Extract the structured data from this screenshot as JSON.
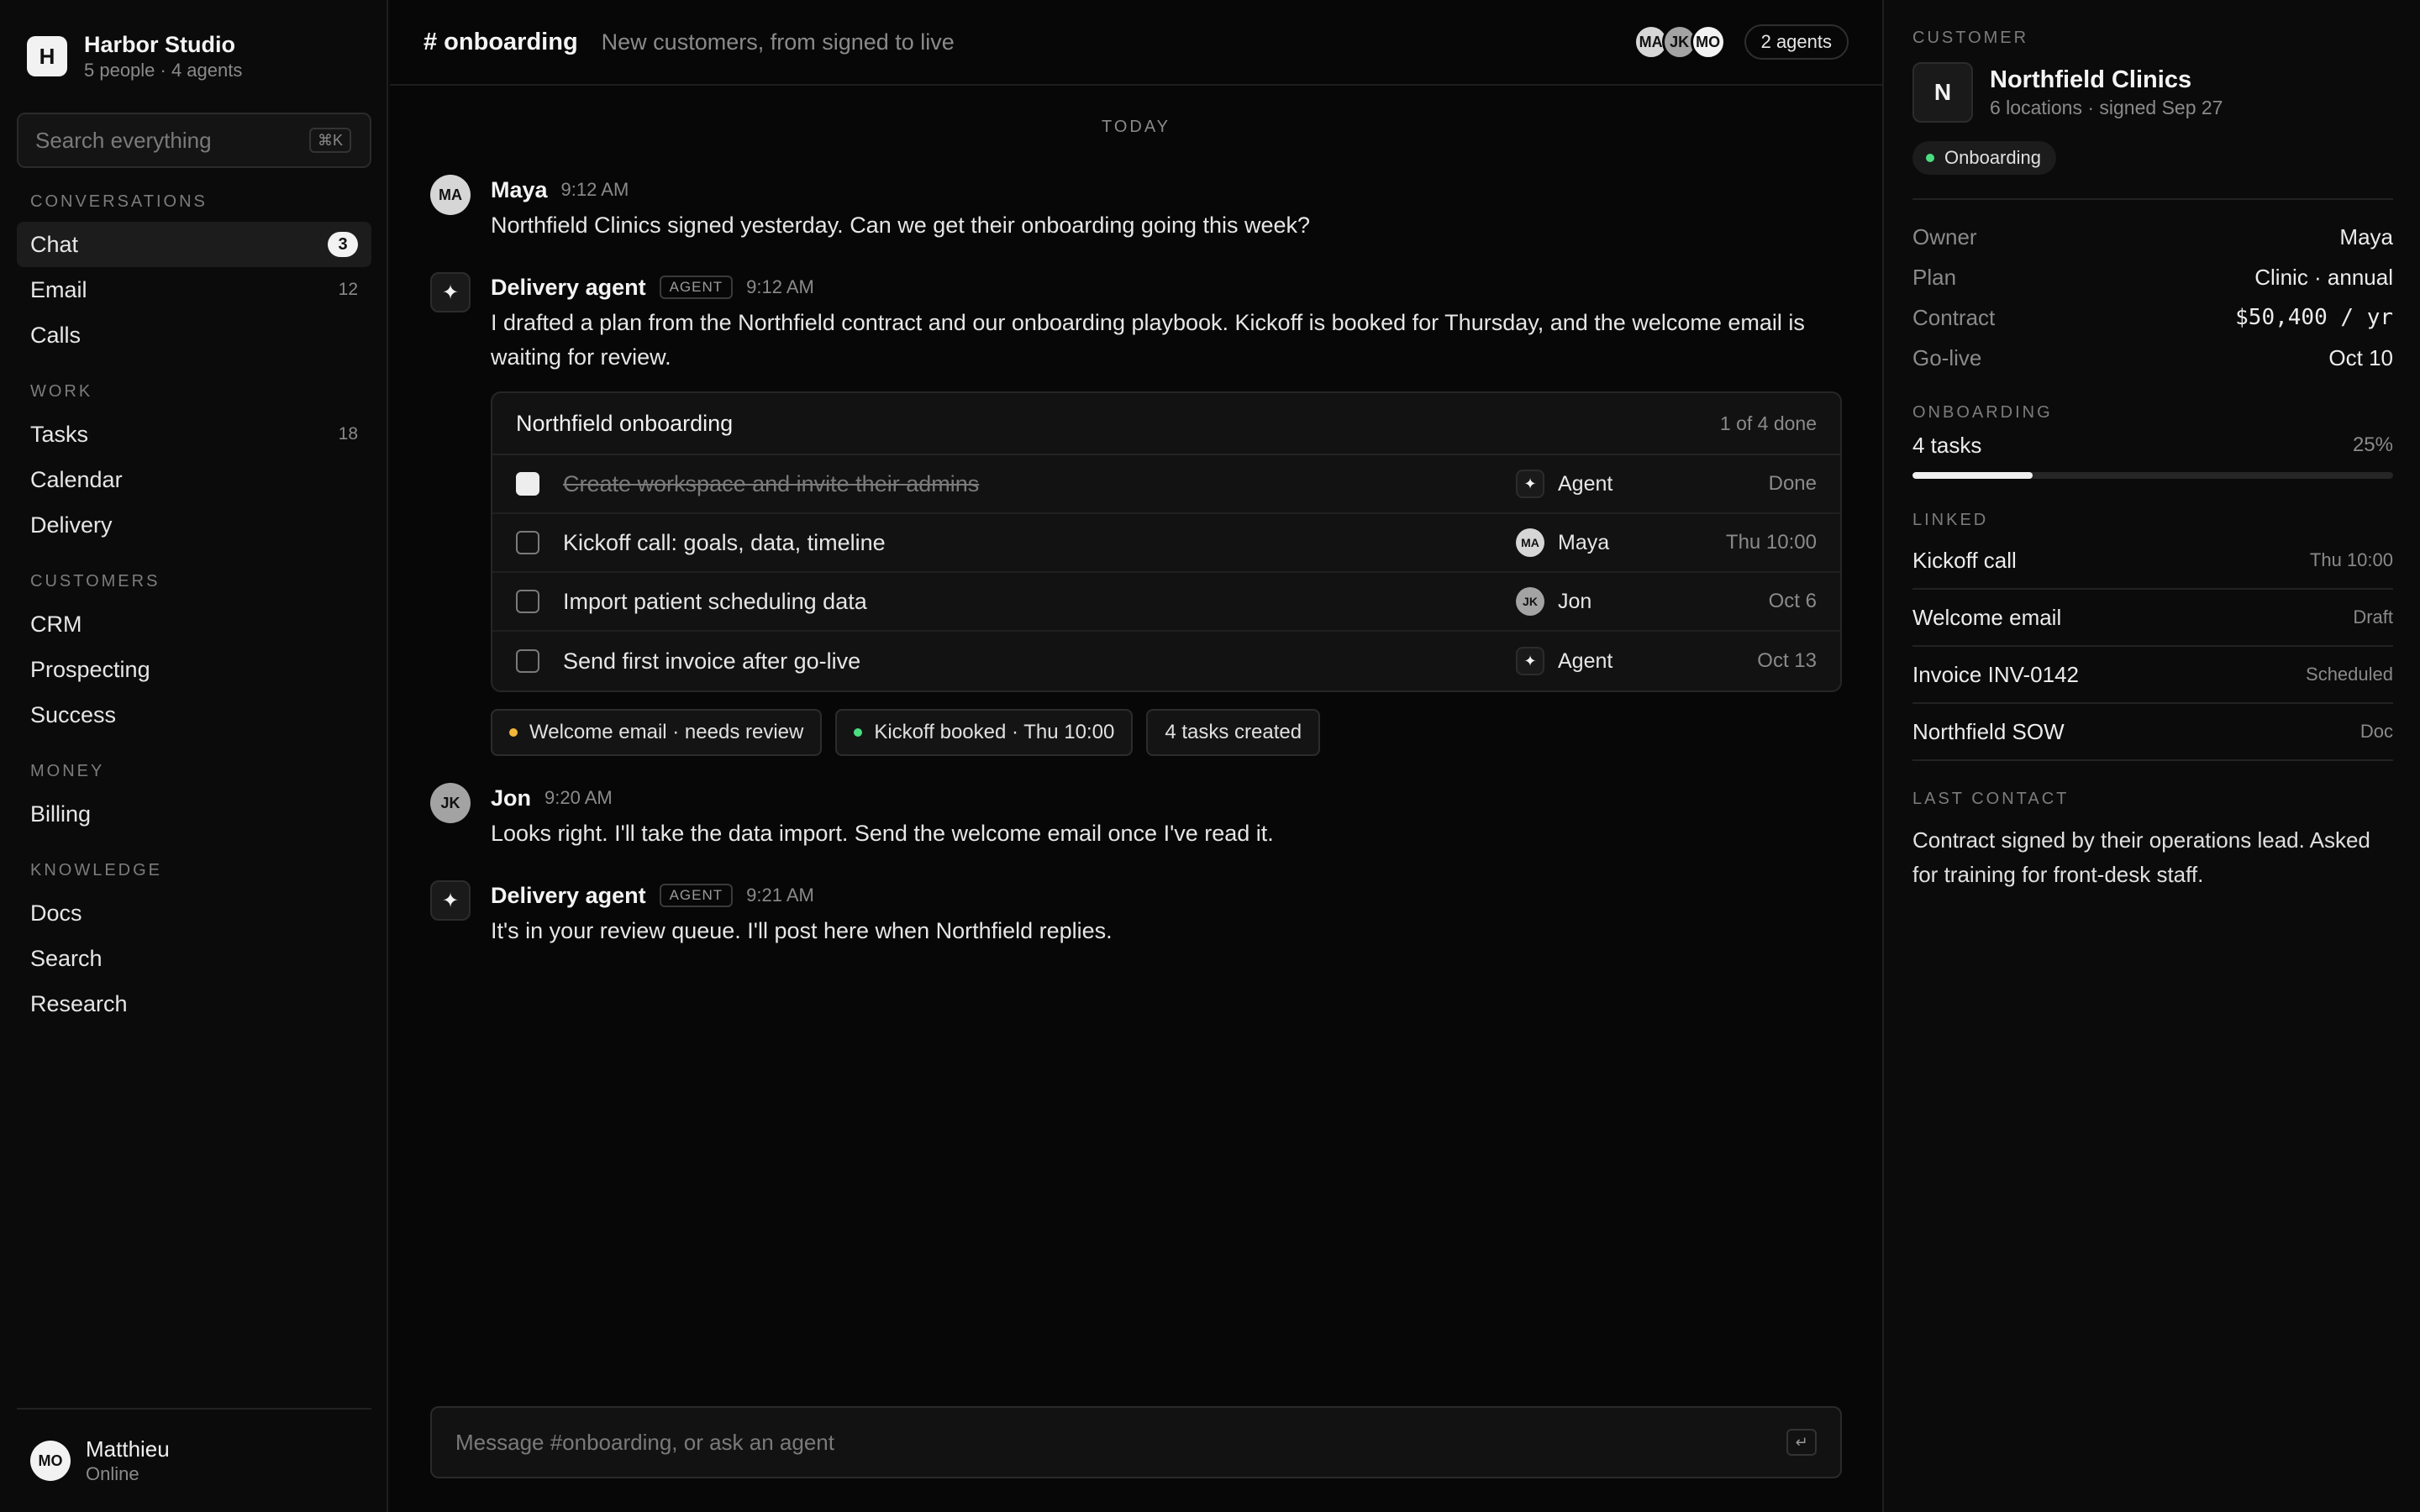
{
  "workspace": {
    "logo": "H",
    "name": "Harbor Studio",
    "sub": "5 people · 4 agents"
  },
  "search": {
    "placeholder": "Search everything",
    "shortcut": "⌘K"
  },
  "nav": [
    {
      "section": "CONVERSATIONS",
      "items": [
        {
          "label": "Chat",
          "badge": "3",
          "active": true
        },
        {
          "label": "Email",
          "count": "12"
        },
        {
          "label": "Calls"
        }
      ]
    },
    {
      "section": "WORK",
      "items": [
        {
          "label": "Tasks",
          "count": "18"
        },
        {
          "label": "Calendar"
        },
        {
          "label": "Delivery"
        }
      ]
    },
    {
      "section": "CUSTOMERS",
      "items": [
        {
          "label": "CRM"
        },
        {
          "label": "Prospecting"
        },
        {
          "label": "Success"
        }
      ]
    },
    {
      "section": "MONEY",
      "items": [
        {
          "label": "Billing"
        }
      ]
    },
    {
      "section": "KNOWLEDGE",
      "items": [
        {
          "label": "Docs"
        },
        {
          "label": "Search"
        },
        {
          "label": "Research"
        }
      ]
    }
  ],
  "me": {
    "initials": "MO",
    "name": "Matthieu",
    "status": "Online"
  },
  "channel": {
    "name": "# onboarding",
    "description": "New customers, from signed to live",
    "members": [
      "MA",
      "JK",
      "MO"
    ],
    "agents_label": "2 agents"
  },
  "day_label": "TODAY",
  "messages": {
    "m1": {
      "initials": "MA",
      "author": "Maya",
      "time": "9:12 AM",
      "text": "Northfield Clinics signed yesterday. Can we get their onboarding going this week?"
    },
    "m2": {
      "icon": "✦",
      "author": "Delivery agent",
      "tag": "AGENT",
      "time": "9:12 AM",
      "text": "I drafted a plan from the Northfield contract and our onboarding playbook. Kickoff is booked for Thursday, and the welcome email is waiting for review."
    },
    "m3": {
      "initials": "JK",
      "author": "Jon",
      "time": "9:20 AM",
      "text": "Looks right. I'll take the data import. Send the welcome email once I've read it."
    },
    "m4": {
      "icon": "✦",
      "author": "Delivery agent",
      "tag": "AGENT",
      "time": "9:21 AM",
      "text": "It's in your review queue. I'll post here when Northfield replies."
    }
  },
  "plan": {
    "title": "Northfield onboarding",
    "progress": "1 of 4 done",
    "tasks": [
      {
        "title": "Create workspace and invite their admins",
        "assignee": "Agent",
        "assignee_type": "agent",
        "due": "Done",
        "done": true
      },
      {
        "title": "Kickoff call: goals, data, timeline",
        "assignee": "Maya",
        "assignee_initials": "MA",
        "assignee_type": "person",
        "due": "Thu 10:00",
        "done": false
      },
      {
        "title": "Import patient scheduling data",
        "assignee": "Jon",
        "assignee_initials": "JK",
        "assignee_type": "person",
        "due": "Oct 6",
        "done": false
      },
      {
        "title": "Send first invoice after go-live",
        "assignee": "Agent",
        "assignee_type": "agent",
        "due": "Oct 13",
        "done": false
      }
    ],
    "chips": [
      {
        "label": "Welcome email · needs review",
        "dot": "amber"
      },
      {
        "label": "Kickoff booked · Thu 10:00",
        "dot": "green"
      },
      {
        "label": "4 tasks created"
      }
    ]
  },
  "composer": {
    "placeholder": "Message #onboarding, or ask an agent",
    "enter": "↵"
  },
  "customer": {
    "section": "CUSTOMER",
    "logo": "N",
    "name": "Northfield Clinics",
    "sub": "6 locations · signed Sep 27",
    "status": "Onboarding",
    "status_color": "#4ade80",
    "fields": [
      {
        "k": "Owner",
        "v": "Maya"
      },
      {
        "k": "Plan",
        "v": "Clinic · annual"
      },
      {
        "k": "Contract",
        "v": "$50,400 / yr",
        "mono": true
      },
      {
        "k": "Go-live",
        "v": "Oct 10"
      }
    ],
    "onboarding": {
      "section": "ONBOARDING",
      "label": "4 tasks",
      "percent_label": "25%",
      "progress": 0.25
    },
    "linked": {
      "section": "LINKED",
      "items": [
        {
          "k": "Kickoff call",
          "v": "Thu 10:00"
        },
        {
          "k": "Welcome email",
          "v": "Draft"
        },
        {
          "k": "Invoice INV-0142",
          "v": "Scheduled"
        },
        {
          "k": "Northfield SOW",
          "v": "Doc"
        }
      ]
    },
    "last_contact": {
      "section": "LAST CONTACT",
      "text": "Contract signed by their operations lead. Asked for training for front-desk staff."
    }
  }
}
